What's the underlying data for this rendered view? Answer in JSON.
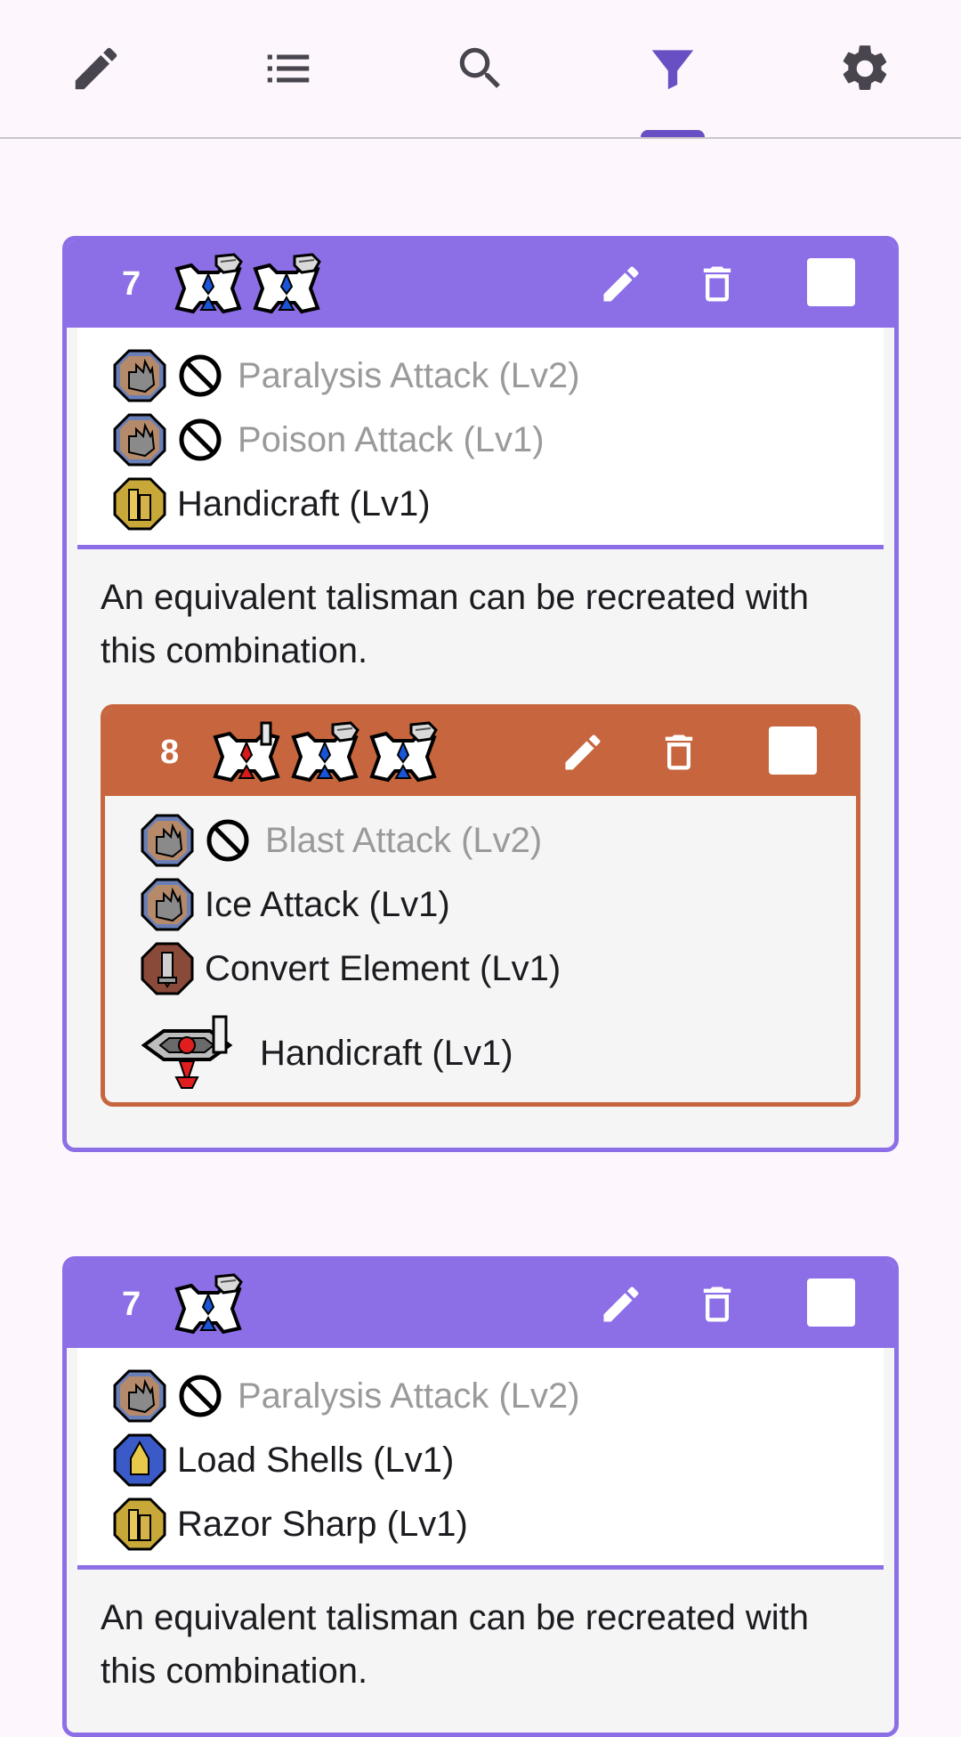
{
  "nav": {
    "tabs": [
      {
        "icon": "pencil-icon"
      },
      {
        "icon": "list-icon"
      },
      {
        "icon": "search-icon"
      },
      {
        "icon": "filter-icon",
        "active": true
      },
      {
        "icon": "gear-icon"
      }
    ],
    "accent": "#6a4fc4"
  },
  "cards": [
    {
      "rarity": "7",
      "header_color": "#8c6fe6",
      "skills": [
        {
          "icon": "attack-skill-icon",
          "label": "Paralysis Attack (Lv2)",
          "excluded": true
        },
        {
          "icon": "attack-skill-icon",
          "label": "Poison Attack (Lv1)",
          "excluded": true
        },
        {
          "icon": "handicraft-skill-icon",
          "label": "Handicraft (Lv1)",
          "excluded": false
        }
      ],
      "note": "An equivalent talisman can be recreated with this combination.",
      "sub": {
        "rarity": "8",
        "header_color": "#c7663e",
        "skills": [
          {
            "icon": "attack-skill-icon",
            "label": "Blast Attack (Lv2)",
            "excluded": true
          },
          {
            "icon": "attack-skill-icon",
            "label": "Ice Attack (Lv1)",
            "excluded": false
          },
          {
            "icon": "convert-element-skill-icon",
            "label": "Convert Element (Lv1)",
            "excluded": false
          }
        ],
        "decoration": {
          "icon": "decoration-jewel-icon",
          "label": "Handicraft (Lv1)"
        }
      }
    },
    {
      "rarity": "7",
      "header_color": "#8c6fe6",
      "skills": [
        {
          "icon": "attack-skill-icon",
          "label": "Paralysis Attack (Lv2)",
          "excluded": true
        },
        {
          "icon": "load-shells-skill-icon",
          "label": "Load Shells (Lv1)",
          "excluded": false
        },
        {
          "icon": "razor-sharp-skill-icon",
          "label": "Razor Sharp (Lv1)",
          "excluded": false
        }
      ],
      "note": "An equivalent talisman can be recreated with this combination."
    }
  ]
}
